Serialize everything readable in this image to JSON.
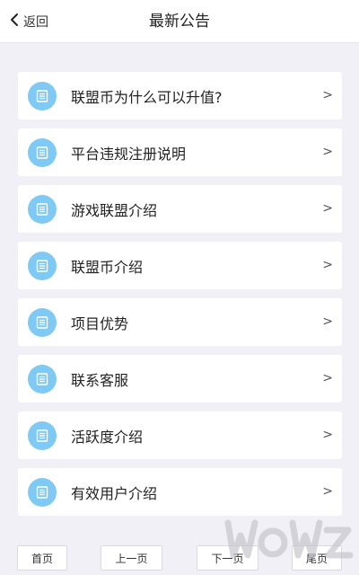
{
  "header": {
    "back_label": "返回",
    "title": "最新公告"
  },
  "notices": [
    {
      "label": "联盟币为什么可以升值?",
      "arrow": ">"
    },
    {
      "label": "平台违规注册说明",
      "arrow": ">"
    },
    {
      "label": "游戏联盟介绍",
      "arrow": ">"
    },
    {
      "label": "联盟币介绍",
      "arrow": ">"
    },
    {
      "label": "项目优势",
      "arrow": ">"
    },
    {
      "label": "联系客服",
      "arrow": ">"
    },
    {
      "label": "活跃度介绍",
      "arrow": ">"
    },
    {
      "label": "有效用户介绍",
      "arrow": ">"
    }
  ],
  "pager": {
    "first": "首页",
    "prev": "上一页",
    "next": "下一页",
    "last": "尾页"
  },
  "colors": {
    "icon_circle": "#7fc9f5",
    "background": "#f1f0f6"
  },
  "icons": {
    "back": "chevron-left-icon",
    "notice": "document-icon"
  }
}
